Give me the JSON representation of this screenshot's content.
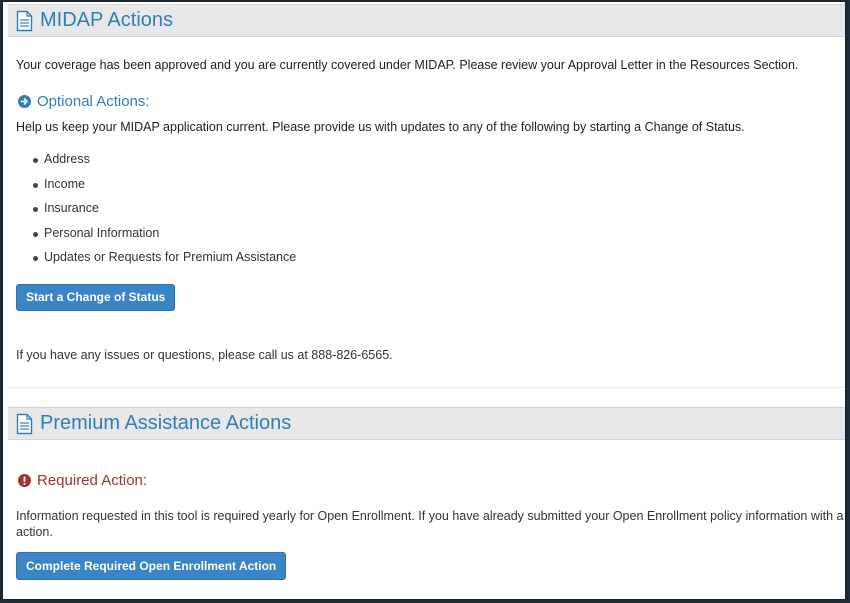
{
  "midap": {
    "title": "MIDAP Actions",
    "status_message": "Your coverage has been approved and you are currently covered under MIDAP. Please review your Approval Letter in the Resources Section.",
    "optional_heading": "Optional Actions:",
    "optional_intro": "Help us keep your MIDAP application current. Please provide us with updates to any of the following by starting a Change of Status.",
    "items": [
      "Address",
      "Income",
      "Insurance",
      "Personal Information",
      "Updates or Requests for Premium Assistance"
    ],
    "change_button": "Start a Change of Status",
    "contact_text": "If you have any issues or questions, please call us at 888-826-6565."
  },
  "premium": {
    "title": "Premium Assistance Actions",
    "required_heading": "Required Action:",
    "required_text_line1": "Information requested in this tool is required yearly for Open Enrollment. If you have already submitted your Open Enrollment policy information with a paper application,",
    "required_text_line2": "action.",
    "complete_button": "Complete Required Open Enrollment Action"
  },
  "colors": {
    "accent": "#2e7fb8",
    "button": "#3a85c6",
    "required": "#a33131",
    "panel_header": "#e8e8e8"
  },
  "icons": {
    "doc": "document-icon",
    "optional": "arrow-circle-right-icon",
    "required": "exclamation-circle-icon"
  }
}
